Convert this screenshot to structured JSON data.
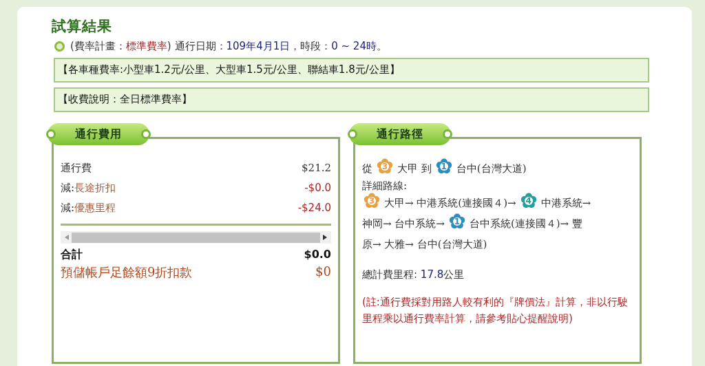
{
  "title": "試算結果",
  "plan": {
    "open": "(費率計畫：",
    "plan_name": "標準費率",
    "close": ")",
    "date_label": "通行日期：",
    "date": "109年4月1日",
    "period_label": "，時段：",
    "period": "0 ~ 24時",
    "end": "。"
  },
  "notices": [
    "【各車種費率:小型車1.2元/公里、大型車1.5元/公里、聯結車1.8元/公里】",
    "【收費說明：全日標準費率】"
  ],
  "fee_panel": {
    "tab": "通行費用",
    "rows": [
      {
        "kind": "base",
        "prefix": "",
        "label": "通行費",
        "amount": "$21.2"
      },
      {
        "kind": "discount",
        "prefix": "減:",
        "label": "長途折扣",
        "amount": "-$0.0"
      },
      {
        "kind": "discount",
        "prefix": "減:",
        "label": "優惠里程",
        "amount": "-$24.0"
      }
    ],
    "total": {
      "label": "合計",
      "amount": "$0.0"
    },
    "prepaid": {
      "label": "預儲帳戶足餘額9折扣款",
      "amount": "$0"
    }
  },
  "route_panel": {
    "tab": "通行路徑",
    "summary": [
      {
        "kind": "text",
        "text": "從"
      },
      {
        "kind": "badge",
        "text": "3",
        "color": "#e8a040"
      },
      {
        "kind": "text",
        "text": "大甲 到"
      },
      {
        "kind": "badge",
        "text": "1",
        "color": "#2a8fc0"
      },
      {
        "kind": "text",
        "text": "台中(台灣大道)"
      }
    ],
    "detail_label": "詳細路線:",
    "detail": [
      {
        "kind": "badge",
        "text": "3",
        "color": "#e8a040"
      },
      {
        "kind": "text",
        "text": "大甲→ 中港系統(連接國４)→"
      },
      {
        "kind": "badge",
        "text": "4",
        "color": "#22a0a0"
      },
      {
        "kind": "text",
        "text": "中港系統→"
      },
      {
        "kind": "text",
        "text": "神岡→ 台中系統→"
      },
      {
        "kind": "badge",
        "text": "1",
        "color": "#2a8fc0"
      },
      {
        "kind": "text",
        "text": "台中系統(連接國４)→ 豐"
      },
      {
        "kind": "text",
        "text": "原→ 大雅→ 台中(台灣大道)"
      }
    ],
    "distance_label": "總計費里程:",
    "distance": "17.8",
    "distance_unit": "公里",
    "note": "(註:通行費採對用路人較有利的『牌價法』計算，非以行駛里程乘以通行費率計算，請參考貼心提醒說明)"
  }
}
